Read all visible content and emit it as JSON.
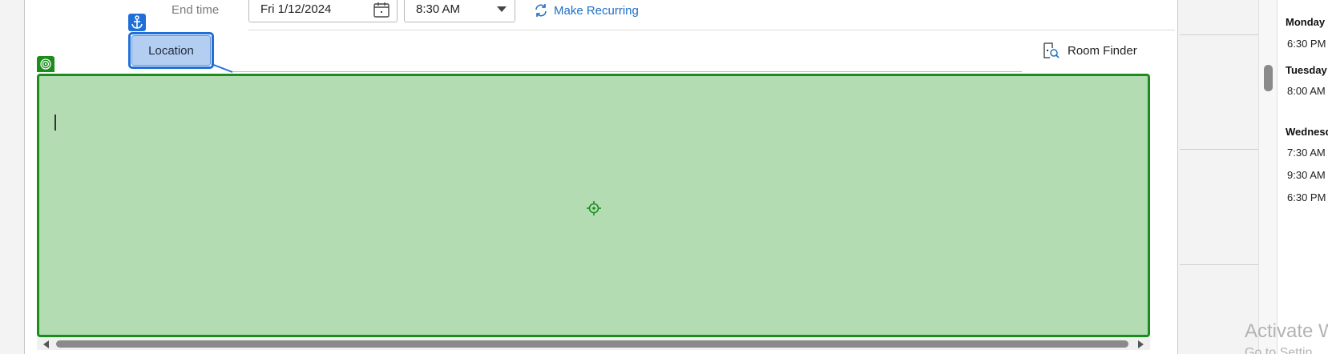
{
  "form": {
    "end_time_label": "End time",
    "end_date": "Fri 1/12/2024",
    "end_time": "8:30 AM",
    "make_recurring": "Make Recurring",
    "location_label": "Location",
    "room_finder": "Room Finder"
  },
  "agenda": {
    "days": [
      {
        "name": "Monday",
        "times": [
          "6:30 PM"
        ]
      },
      {
        "name": "Tuesday",
        "times": [
          "8:00 AM"
        ]
      },
      {
        "name": "Wednesday",
        "times": [
          "7:30 AM",
          "9:30 AM",
          "6:30 PM"
        ]
      }
    ]
  },
  "watermark": {
    "line1": "Activate W",
    "line2": "Go to Settin"
  },
  "colors": {
    "accent_blue": "#1f6fd8",
    "link_blue": "#1f6fc4",
    "highlight_green": "#1b8d1b",
    "body_fill_green": "#b3dcb3",
    "location_fill": "#b4cef2"
  }
}
